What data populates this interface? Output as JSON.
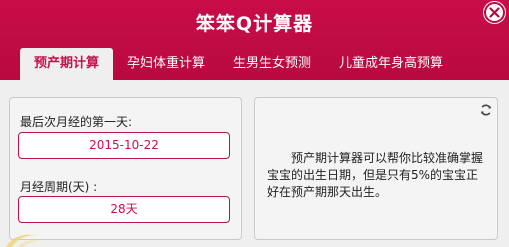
{
  "app": {
    "title": "笨笨Q计算器",
    "close_icon": "close-icon"
  },
  "tabs": [
    {
      "label": "预产期计算",
      "active": true
    },
    {
      "label": "孕妇体重计算",
      "active": false
    },
    {
      "label": "生男生女预测",
      "active": false
    },
    {
      "label": "儿童成年身高预算",
      "active": false
    }
  ],
  "form": {
    "last_period_label": "最后次月经的第一天:",
    "last_period_value": "2015-10-22",
    "cycle_label": "月经周期(天) :",
    "cycle_value": "28天"
  },
  "info": {
    "refresh_icon": "refresh-icon",
    "text": "预产期计算器可以帮你比较准确掌握宝宝的出生日期，但是只有5%的宝宝正好在预产期那天出生。"
  },
  "colors": {
    "brand": "#c0104a",
    "background": "#efefef",
    "panel": "#f4f4f4"
  }
}
